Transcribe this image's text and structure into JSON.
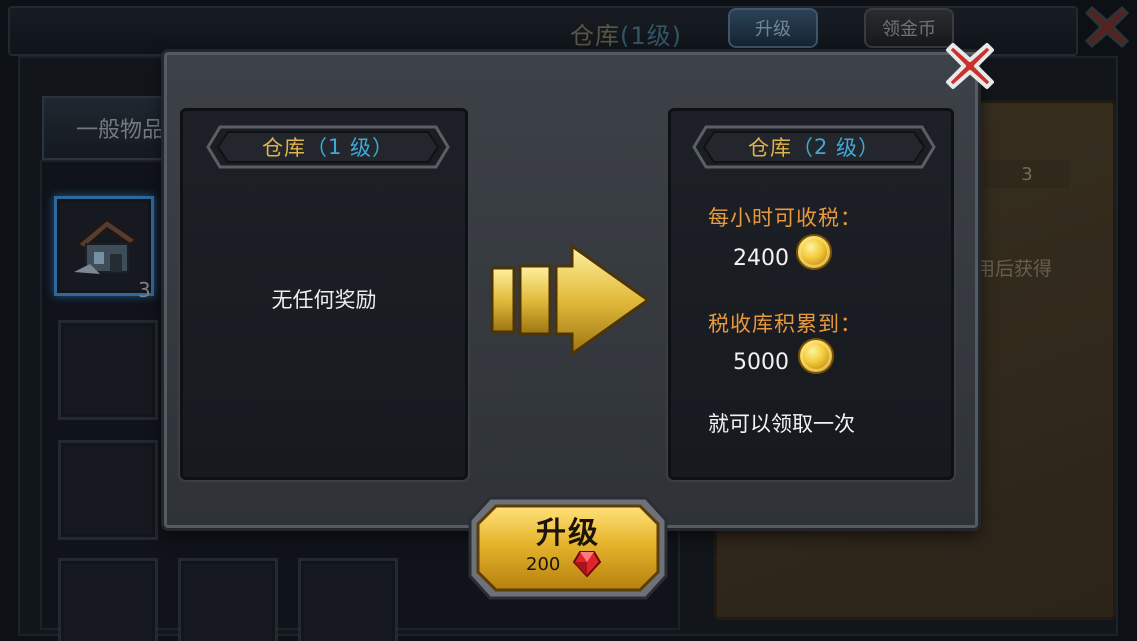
{
  "background": {
    "title_name": "仓库",
    "title_level": "(1级)",
    "upgrade_tab": "升级",
    "coins_tab": "领金币",
    "category_tab": "一般物品",
    "slot_count": "3",
    "scroll_number": "3",
    "scroll_text": "用后获得"
  },
  "modal": {
    "current": {
      "name": "仓库",
      "open": "（",
      "level": "1",
      "unit": "级",
      "close": "）",
      "reward_text": "无任何奖励"
    },
    "next": {
      "name": "仓库",
      "open": "（",
      "level": "2",
      "unit": "级",
      "close": "）",
      "tax_label": "每小时可收税：",
      "tax_value": "2400",
      "storage_label": "税收库积累到：",
      "storage_value": "5000",
      "note": "就可以领取一次"
    },
    "upgrade_button": {
      "label": "升级",
      "cost": "200"
    }
  },
  "colors": {
    "gold_text": "#e0b44a",
    "level_blue": "#3fa9d6",
    "label_orange": "#e79a3c",
    "button_gold": "#e6b42c"
  },
  "icons": [
    "close-icon",
    "gold-coin-icon",
    "ruby-gem-icon",
    "arrow-right-icon",
    "house-icon"
  ]
}
